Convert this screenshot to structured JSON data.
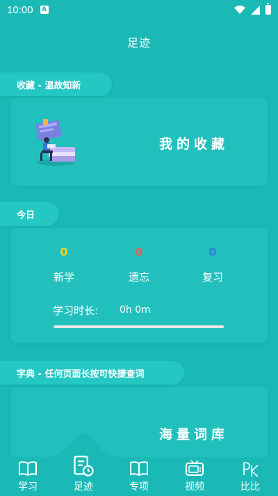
{
  "status": {
    "time": "10:00",
    "notif_badge": "A"
  },
  "header": {
    "title": "足迹"
  },
  "favorites": {
    "section_label": "收藏 - 温故知新",
    "card_text": "我的收藏"
  },
  "today": {
    "section_label": "今日",
    "stats": [
      {
        "value": "0",
        "label": "新学",
        "color": "#f5d21b"
      },
      {
        "value": "0",
        "label": "遗忘",
        "color": "#ef5a5a"
      },
      {
        "value": "0",
        "label": "复习",
        "color": "#2a7fe0"
      }
    ],
    "duration_label": "学习时长:",
    "duration_value": "0h 0m",
    "progress_fraction": 0
  },
  "dictionary": {
    "section_label": "字典 - 任何页面长按可快捷查词",
    "card_text": "海量词库"
  },
  "tabs": [
    {
      "label": "学习",
      "icon": "book-icon"
    },
    {
      "label": "足迹",
      "icon": "footprint-icon",
      "active": true
    },
    {
      "label": "专项",
      "icon": "book-icon"
    },
    {
      "label": "视频",
      "icon": "tv-icon"
    },
    {
      "label": "比比",
      "icon": "pk-icon"
    }
  ],
  "colors": {
    "background": "#1bb9b6",
    "card": "#22c0bd"
  }
}
